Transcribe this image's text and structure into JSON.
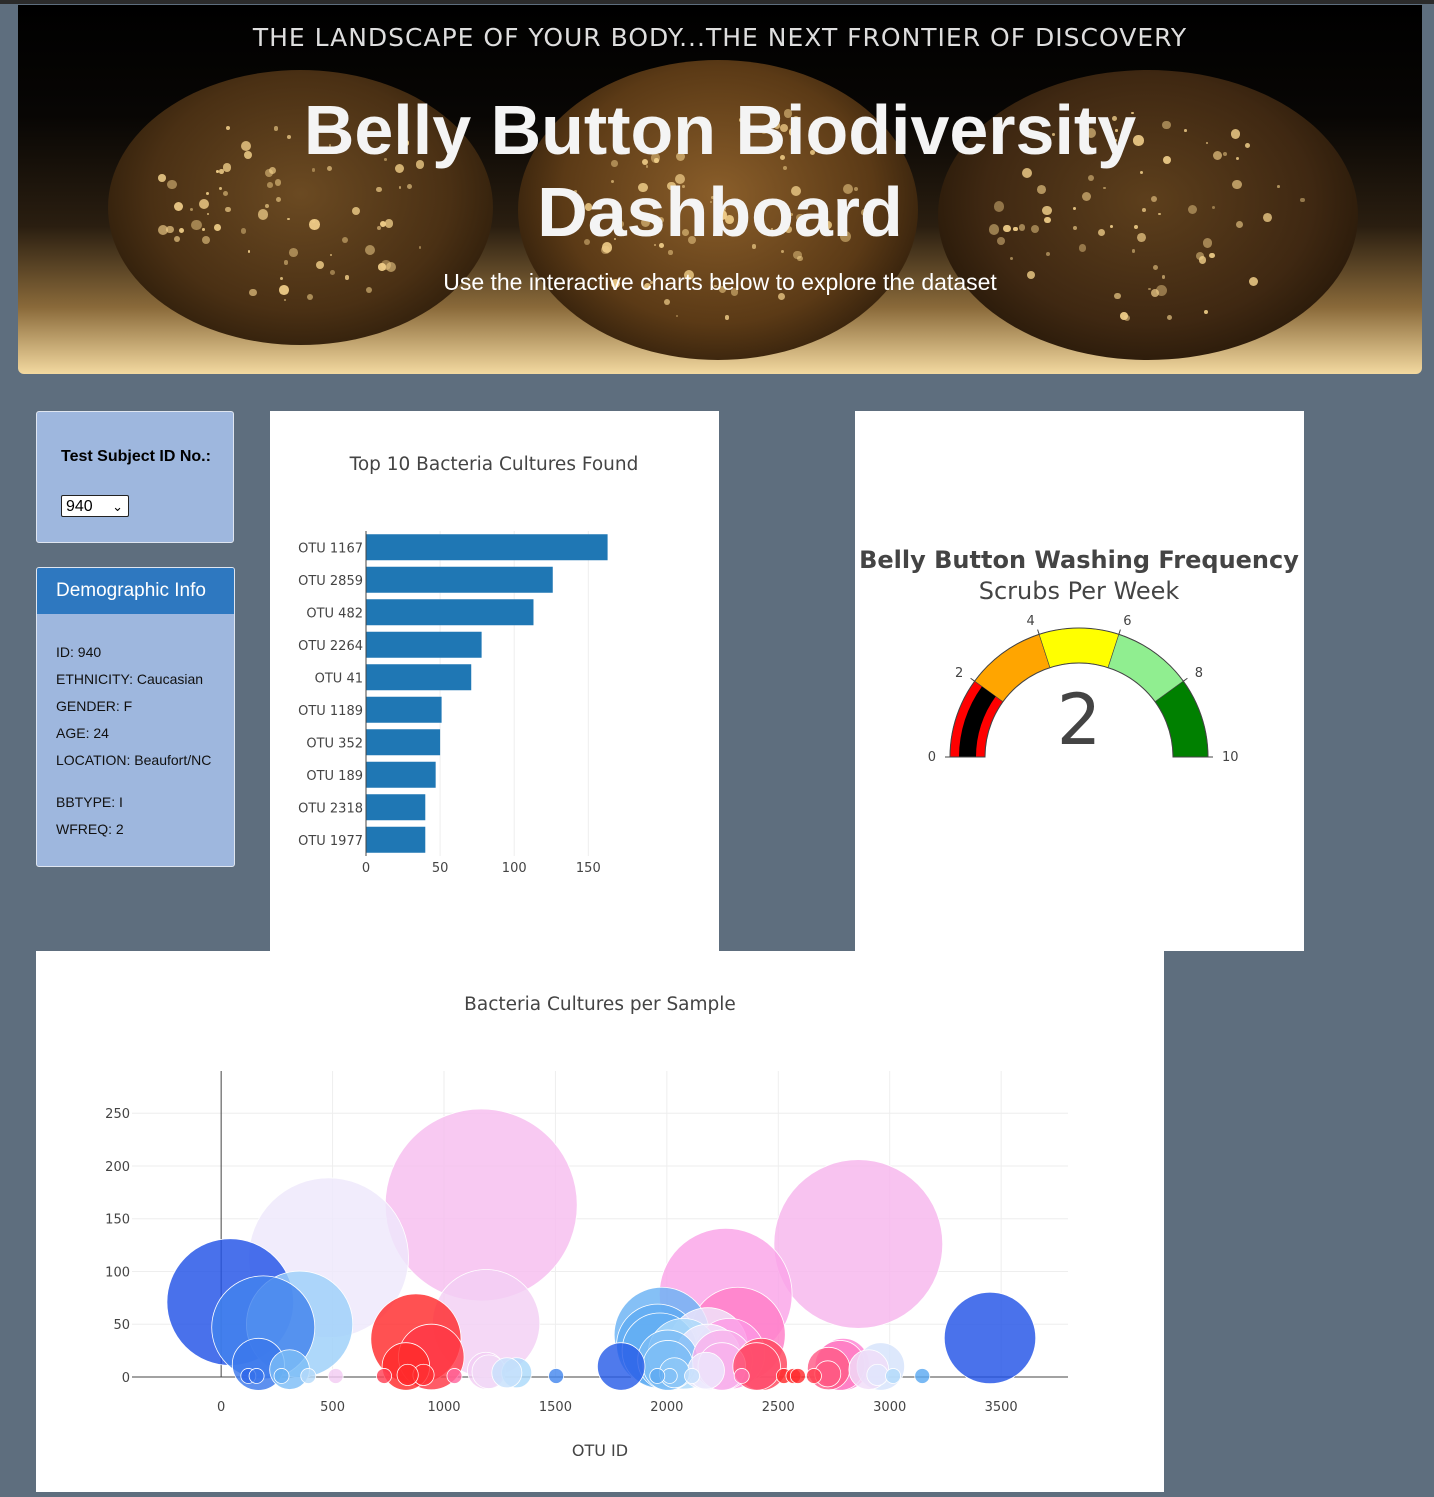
{
  "banner": {
    "tagline": "THE LANDSCAPE OF YOUR BODY...THE NEXT FRONTIER OF DISCOVERY",
    "title_line1": "Belly Button Biodiversity",
    "title_line2": "Dashboard",
    "subtitle": "Use the interactive charts below to explore the dataset"
  },
  "selector": {
    "label": "Test Subject ID No.:",
    "selected": "940"
  },
  "demographics": {
    "header": "Demographic Info",
    "lines": [
      "ID: 940",
      "ETHNICITY: Caucasian",
      "GENDER: F",
      "AGE: 24",
      "LOCATION: Beaufort/NC",
      "BBTYPE: I",
      "WFREQ: 2"
    ]
  },
  "chart_data": [
    {
      "type": "bar",
      "orientation": "horizontal",
      "title": "Top 10 Bacteria Cultures Found",
      "categories": [
        "OTU 1167",
        "OTU 2859",
        "OTU 482",
        "OTU 2264",
        "OTU 41",
        "OTU 1189",
        "OTU 352",
        "OTU 189",
        "OTU 2318",
        "OTU 1977"
      ],
      "values": [
        163,
        126,
        113,
        78,
        71,
        51,
        50,
        47,
        40,
        40
      ],
      "xlim": [
        0,
        168
      ],
      "xticks": [
        0,
        50,
        100,
        150
      ],
      "color": "#1f77b4",
      "grid": true
    },
    {
      "type": "gauge",
      "title": "Belly Button Washing Frequency",
      "subtitle": "Scrubs Per Week",
      "value": 2,
      "range": [
        0,
        10
      ],
      "ticks": [
        0,
        2,
        4,
        6,
        8,
        10
      ],
      "steps": [
        {
          "range": [
            0,
            2
          ],
          "color": "#ff0000"
        },
        {
          "range": [
            2,
            4
          ],
          "color": "#ffa500"
        },
        {
          "range": [
            4,
            6
          ],
          "color": "#ffff00"
        },
        {
          "range": [
            6,
            8
          ],
          "color": "#90ee90"
        },
        {
          "range": [
            8,
            10
          ],
          "color": "#008000"
        }
      ],
      "bar_color": "#000000"
    },
    {
      "type": "scatter",
      "subtype": "bubble",
      "title": "Bacteria Cultures per Sample",
      "xlabel": "OTU ID",
      "xlim": [
        -400,
        3800
      ],
      "ylim": [
        0,
        290
      ],
      "xticks": [
        0,
        500,
        1000,
        1500,
        2000,
        2500,
        3000,
        3500
      ],
      "yticks": [
        0,
        50,
        100,
        150,
        200,
        250
      ],
      "grid": true,
      "colorscale": [
        "#1f4fe6",
        "#5aa8f2",
        "#a9d8fa",
        "#eeeafc",
        "#ff8ae0",
        "#ff2a2a"
      ],
      "points": [
        {
          "x": 1167,
          "y": 163
        },
        {
          "x": 2859,
          "y": 126
        },
        {
          "x": 482,
          "y": 113
        },
        {
          "x": 2264,
          "y": 78
        },
        {
          "x": 41,
          "y": 71
        },
        {
          "x": 1189,
          "y": 51
        },
        {
          "x": 352,
          "y": 50
        },
        {
          "x": 189,
          "y": 47
        },
        {
          "x": 2318,
          "y": 40
        },
        {
          "x": 1977,
          "y": 40
        },
        {
          "x": 3450,
          "y": 37
        },
        {
          "x": 874,
          "y": 36
        },
        {
          "x": 1959,
          "y": 30
        },
        {
          "x": 2184,
          "y": 28
        },
        {
          "x": 1968,
          "y": 25
        },
        {
          "x": 2281,
          "y": 22
        },
        {
          "x": 2074,
          "y": 22
        },
        {
          "x": 943,
          "y": 19
        },
        {
          "x": 2184,
          "y": 19
        },
        {
          "x": 2004,
          "y": 16
        },
        {
          "x": 2249,
          "y": 16
        },
        {
          "x": 2424,
          "y": 12
        },
        {
          "x": 2791,
          "y": 12
        },
        {
          "x": 167,
          "y": 12
        },
        {
          "x": 2005,
          "y": 11
        },
        {
          "x": 2247,
          "y": 10
        },
        {
          "x": 2777,
          "y": 11
        },
        {
          "x": 829,
          "y": 10
        },
        {
          "x": 1795,
          "y": 10
        },
        {
          "x": 2403,
          "y": 10
        },
        {
          "x": 2960,
          "y": 10
        },
        {
          "x": 2726,
          "y": 8
        },
        {
          "x": 2906,
          "y": 7
        },
        {
          "x": 307,
          "y": 7
        },
        {
          "x": 1188,
          "y": 6
        },
        {
          "x": 1201,
          "y": 5
        },
        {
          "x": 2176,
          "y": 6
        },
        {
          "x": 1326,
          "y": 4
        },
        {
          "x": 1282,
          "y": 4
        },
        {
          "x": 2034,
          "y": 4
        },
        {
          "x": 2722,
          "y": 3
        },
        {
          "x": 2945,
          "y": 2
        },
        {
          "x": 908,
          "y": 2
        },
        {
          "x": 837,
          "y": 2
        },
        {
          "x": 2013,
          "y": 1
        },
        {
          "x": 122,
          "y": 1
        },
        {
          "x": 159,
          "y": 1
        },
        {
          "x": 271,
          "y": 1
        },
        {
          "x": 391,
          "y": 1
        },
        {
          "x": 514,
          "y": 1
        },
        {
          "x": 731,
          "y": 1
        },
        {
          "x": 1047,
          "y": 1
        },
        {
          "x": 1503,
          "y": 1
        },
        {
          "x": 1957,
          "y": 1
        },
        {
          "x": 2113,
          "y": 1
        },
        {
          "x": 2336,
          "y": 1
        },
        {
          "x": 2525,
          "y": 1
        },
        {
          "x": 2568,
          "y": 1
        },
        {
          "x": 2588,
          "y": 1
        },
        {
          "x": 2660,
          "y": 1
        },
        {
          "x": 3015,
          "y": 1
        },
        {
          "x": 3146,
          "y": 1
        }
      ]
    }
  ]
}
